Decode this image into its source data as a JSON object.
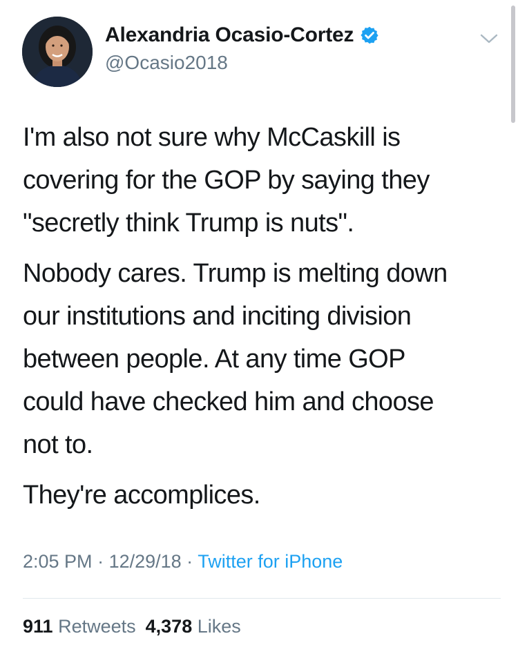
{
  "author": {
    "display_name": "Alexandria Ocasio-Cortez",
    "handle": "@Ocasio2018",
    "verified": true
  },
  "icons": {
    "avatar": "profile-photo",
    "verified": "verified-badge-icon",
    "menu": "chevron-down-icon"
  },
  "tweet": {
    "paragraphs": [
      "I'm also not sure why McCaskill is\ncovering for the GOP by saying they\n\"secretly think Trump is nuts\".",
      "Nobody cares. Trump is melting down\nour institutions and inciting division\nbetween people. At any time GOP\ncould have checked him and choose\nnot to.",
      "They're accomplices."
    ]
  },
  "meta": {
    "time": "2:05 PM",
    "sep1": " · ",
    "date": "12/29/18",
    "sep2": " · ",
    "source": "Twitter for iPhone"
  },
  "stats": {
    "retweets_count": "911",
    "retweets_label": "Retweets",
    "likes_count": "4,378",
    "likes_label": "Likes"
  },
  "colors": {
    "text": "#14171a",
    "secondary": "#657786",
    "link": "#1da1f2",
    "divider": "#e1e8ed"
  }
}
